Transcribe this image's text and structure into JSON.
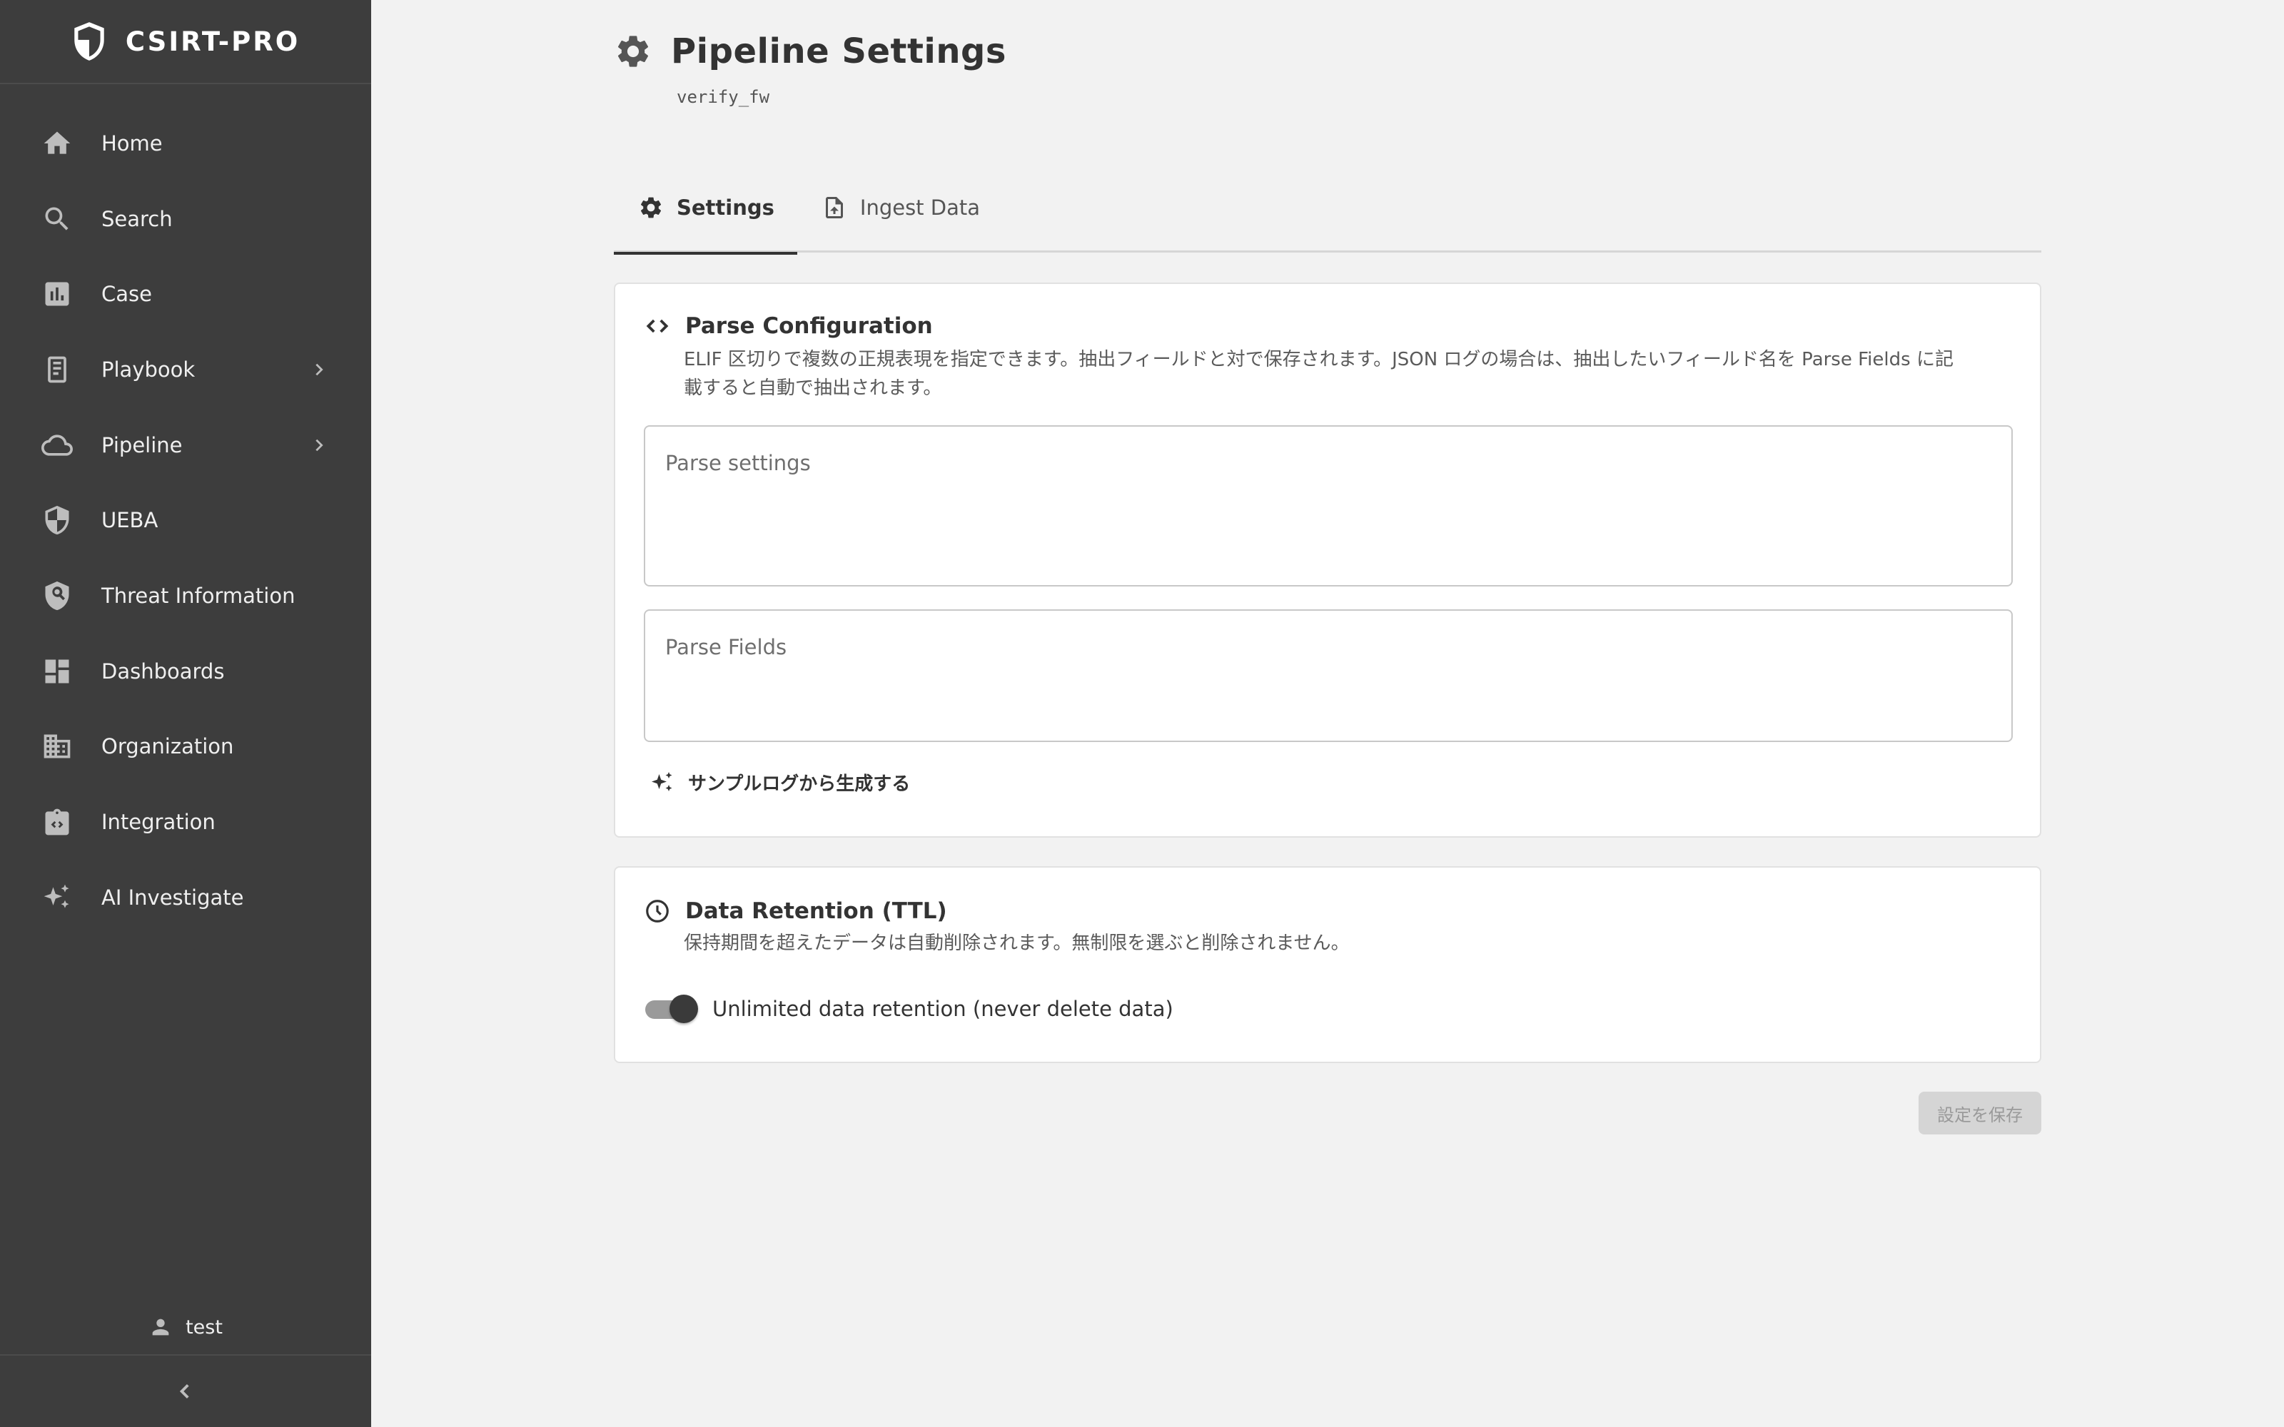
{
  "app": {
    "brand": "CSIRT-PRO",
    "brand_icon": "shield-icon"
  },
  "sidebar": {
    "items": [
      {
        "label": "Home",
        "icon": "home-icon"
      },
      {
        "label": "Search",
        "icon": "search-icon"
      },
      {
        "label": "Case",
        "icon": "chart-icon"
      },
      {
        "label": "Playbook",
        "icon": "book-icon",
        "has_submenu": true
      },
      {
        "label": "Pipeline",
        "icon": "cloud-icon",
        "has_submenu": true
      },
      {
        "label": "UEBA",
        "icon": "shield-icon"
      },
      {
        "label": "Threat Information",
        "icon": "threat-search-icon"
      },
      {
        "label": "Dashboards",
        "icon": "dashboard-icon"
      },
      {
        "label": "Organization",
        "icon": "building-icon"
      },
      {
        "label": "Integration",
        "icon": "integration-icon"
      },
      {
        "label": "AI Investigate",
        "icon": "sparkle-icon"
      }
    ],
    "user": "test"
  },
  "page": {
    "title": "Pipeline Settings",
    "subtitle": "verify_fw"
  },
  "tabs": [
    {
      "label": "Settings",
      "icon": "gear-icon",
      "active": true
    },
    {
      "label": "Ingest Data",
      "icon": "file-upload-icon",
      "active": false
    }
  ],
  "parse": {
    "title": "Parse Configuration",
    "description": "ELIF 区切りで複数の正規表現を指定できます。抽出フィールドと対で保存されます。JSON ログの場合は、抽出したいフィールド名を Parse Fields に記載すると自動で抽出されます。",
    "settings_placeholder": "Parse settings",
    "settings_value": "",
    "fields_placeholder": "Parse Fields",
    "fields_value": "",
    "generate_label": "サンプルログから生成する"
  },
  "retention": {
    "title": "Data Retention (TTL)",
    "description": "保持期間を超えたデータは自動削除されます。無制限を選ぶと削除されません。",
    "unlimited_label": "Unlimited data retention (never delete data)",
    "unlimited_enabled": true
  },
  "save_label": "設定を保存",
  "colors": {
    "sidebar_bg": "#3d3d3d",
    "page_bg": "#f2f2f2",
    "accent": "#333333",
    "disabled_button": "#d5d5d5"
  }
}
